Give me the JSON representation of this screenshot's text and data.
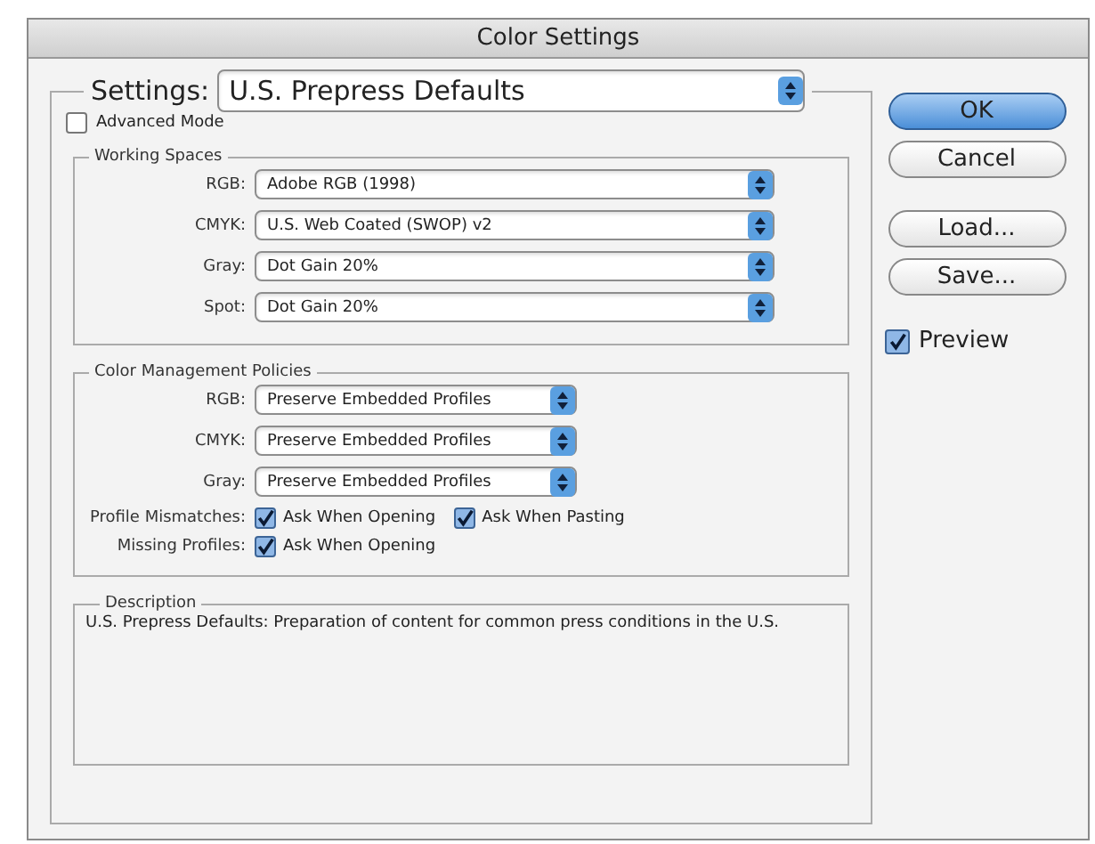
{
  "window": {
    "title": "Color Settings"
  },
  "settings": {
    "label": "Settings:",
    "value": "U.S. Prepress Defaults"
  },
  "advanced_mode": {
    "label": "Advanced Mode",
    "checked": false
  },
  "working_spaces": {
    "title": "Working Spaces",
    "rows": [
      {
        "label": "RGB:",
        "value": "Adobe RGB (1998)"
      },
      {
        "label": "CMYK:",
        "value": "U.S. Web Coated (SWOP) v2"
      },
      {
        "label": "Gray:",
        "value": "Dot Gain 20%"
      },
      {
        "label": "Spot:",
        "value": "Dot Gain 20%"
      }
    ]
  },
  "policies": {
    "title": "Color Management Policies",
    "rows": [
      {
        "label": "RGB:",
        "value": "Preserve Embedded Profiles"
      },
      {
        "label": "CMYK:",
        "value": "Preserve Embedded Profiles"
      },
      {
        "label": "Gray:",
        "value": "Preserve Embedded Profiles"
      }
    ],
    "checks": [
      {
        "label": "Profile Mismatches:",
        "options": [
          {
            "label": "Ask When Opening",
            "checked": true
          },
          {
            "label": "Ask When Pasting",
            "checked": true
          }
        ]
      },
      {
        "label": "Missing Profiles:",
        "options": [
          {
            "label": "Ask When Opening",
            "checked": true
          }
        ]
      }
    ]
  },
  "description": {
    "title": "Description",
    "text": "U.S. Prepress Defaults:  Preparation of content for common press conditions in the U.S."
  },
  "buttons": [
    {
      "label": "OK",
      "default": true
    },
    {
      "label": "Cancel",
      "default": false
    },
    {
      "label": "Load...",
      "default": false
    },
    {
      "label": "Save...",
      "default": false
    }
  ],
  "preview": {
    "label": "Preview",
    "checked": true
  }
}
